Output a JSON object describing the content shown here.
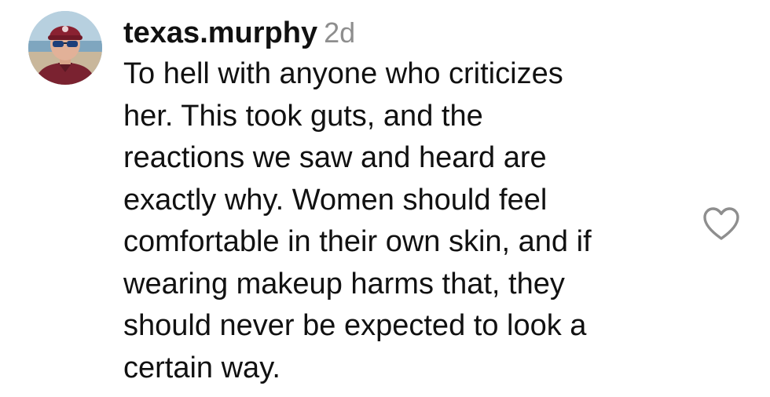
{
  "comment": {
    "username": "texas.murphy",
    "timestamp": "2d",
    "text_lines": [
      "To hell with anyone who criticizes",
      "her. This took guts, and the",
      "reactions we saw and heard are",
      "exactly why. Women should feel",
      "comfortable in their own skin, and if",
      "wearing makeup harms that, they",
      "should never be expected to look a",
      "certain way."
    ],
    "like_icon": "heart-outline-icon",
    "avatar_icon": "user-avatar-photo"
  },
  "colors": {
    "text": "#111111",
    "timestamp": "#8e8e8e",
    "icon": "#8e8e8e",
    "background": "#ffffff"
  }
}
